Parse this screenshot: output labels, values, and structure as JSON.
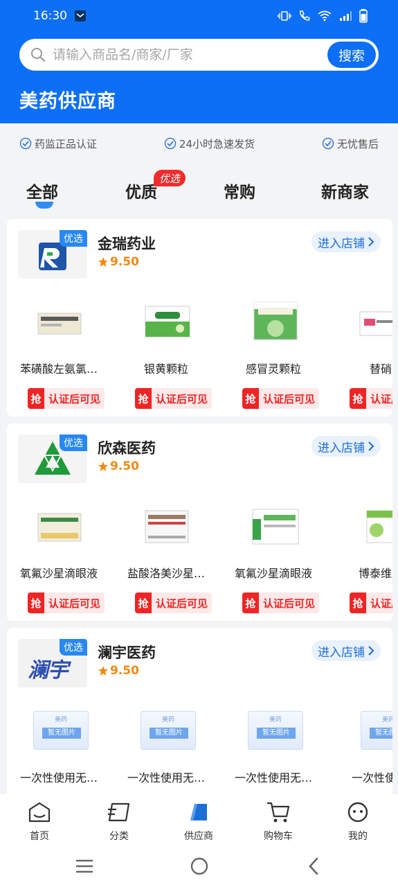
{
  "status_bar": {
    "time": "16:30"
  },
  "search": {
    "placeholder": "请输入商品名/商家/厂家",
    "button_label": "搜索"
  },
  "brand_title": "美药供应商",
  "guarantees": [
    "药监正品认证",
    "24小时急速发货",
    "无忧售后"
  ],
  "tabs": [
    {
      "label": "全部",
      "active": true
    },
    {
      "label": "优质",
      "badge": "优选"
    },
    {
      "label": "常购"
    },
    {
      "label": "新商家"
    }
  ],
  "stores": [
    {
      "name": "金瑞药业",
      "tag": "优选",
      "rating": "9.50",
      "enter_label": "进入店铺",
      "products": [
        {
          "name": "苯磺酸左氨氯…",
          "qiang": "抢",
          "price_text": "认证后可见"
        },
        {
          "name": "银黄颗粒",
          "qiang": "抢",
          "price_text": "认证后可见"
        },
        {
          "name": "感冒灵颗粒",
          "qiang": "抢",
          "price_text": "认证后可见"
        },
        {
          "name": "替硝",
          "qiang": "抢",
          "price_text": "认证后可见"
        }
      ]
    },
    {
      "name": "欣森医药",
      "tag": "优选",
      "rating": "9.50",
      "enter_label": "进入店铺",
      "products": [
        {
          "name": "氧氟沙星滴眼液",
          "qiang": "抢",
          "price_text": "认证后可见"
        },
        {
          "name": "盐酸洛美沙星…",
          "qiang": "抢",
          "price_text": "认证后可见"
        },
        {
          "name": "氧氟沙星滴眼液",
          "qiang": "抢",
          "price_text": "认证后可见"
        },
        {
          "name": "博泰维康",
          "qiang": "抢",
          "price_text": "认证后可见"
        }
      ]
    },
    {
      "name": "澜宇医药",
      "tag": "优选",
      "logo_text": "澜宇",
      "rating": "9.50",
      "enter_label": "进入店铺",
      "products": [
        {
          "name": "一次性使用无…",
          "img_text": "暂无图片",
          "img_brand": "美药"
        },
        {
          "name": "一次性使用无…",
          "img_text": "暂无图片",
          "img_brand": "美药"
        },
        {
          "name": "一次性使用无…",
          "img_text": "暂无图片",
          "img_brand": "美药"
        },
        {
          "name": "一次性使",
          "img_text": "暂无图片",
          "img_brand": "美药"
        }
      ]
    }
  ],
  "bottom_nav": [
    {
      "label": "首页",
      "icon": "home-icon"
    },
    {
      "label": "分类",
      "icon": "category-icon"
    },
    {
      "label": "供应商",
      "icon": "supplier-icon",
      "active": true
    },
    {
      "label": "购物车",
      "icon": "cart-icon"
    },
    {
      "label": "我的",
      "icon": "profile-icon"
    }
  ],
  "colors": {
    "primary": "#0d6ff5",
    "rating": "#f08a13",
    "price_red": "#ef2424"
  }
}
